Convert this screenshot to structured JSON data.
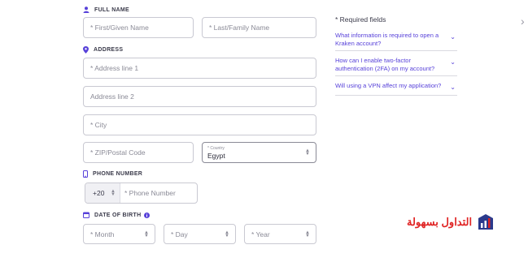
{
  "form": {
    "full_name": {
      "label": "FULL NAME",
      "first_placeholder": "* First/Given Name",
      "last_placeholder": "* Last/Family Name"
    },
    "address": {
      "label": "ADDRESS",
      "line1_placeholder": "* Address line 1",
      "line2_placeholder": "Address line 2",
      "city_placeholder": "* City",
      "zip_placeholder": "* ZIP/Postal Code",
      "country_label": "* Country",
      "country_value": "Egypt"
    },
    "phone": {
      "label": "PHONE NUMBER",
      "prefix_value": "+20",
      "number_placeholder": "* Phone Number"
    },
    "dob": {
      "label": "DATE OF BIRTH",
      "month_placeholder": "* Month",
      "day_placeholder": "* Day",
      "year_placeholder": "* Year"
    }
  },
  "sidebar": {
    "required_note": "* Required fields",
    "faq": [
      {
        "question": "What information is required to open a Kraken account?"
      },
      {
        "question": "How can I enable two-factor authentication (2FA) on my account?"
      },
      {
        "question": "Will using a VPN affect my application?"
      }
    ]
  },
  "watermark": {
    "text": "التداول بسهولة"
  },
  "colors": {
    "accent": "#5741d9",
    "border": "#c9c9d2",
    "watermark_red": "#e02424",
    "watermark_blue": "#2b3a8c"
  },
  "icons": [
    "user-icon",
    "location-pin-icon",
    "phone-icon",
    "calendar-icon",
    "info-icon",
    "chevron-down-icon",
    "chevron-right-icon"
  ]
}
